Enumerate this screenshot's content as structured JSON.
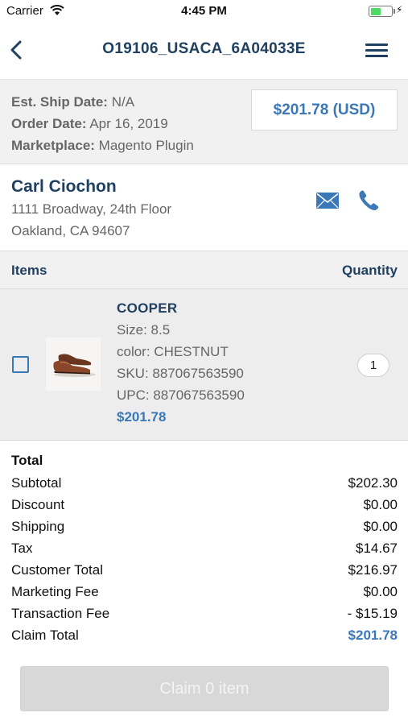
{
  "status_bar": {
    "carrier": "Carrier",
    "time": "4:45 PM",
    "battery_level": 0.45
  },
  "nav": {
    "title": "O19106_USACA_6A04033E",
    "back_icon": "chevron-left-icon",
    "menu_icon": "hamburger-menu-icon"
  },
  "order": {
    "ship_label": "Est. Ship Date:",
    "ship_value": "N/A",
    "date_label": "Order Date:",
    "date_value": "Apr 16, 2019",
    "marketplace_label": "Marketplace:",
    "marketplace_value": "Magento Plugin",
    "price": "$201.78 (USD)"
  },
  "customer": {
    "name": "Carl Ciochon",
    "address_line1": "1111 Broadway, 24th Floor",
    "address_line2": "Oakland, CA 94607",
    "mail_icon": "mail-icon",
    "phone_icon": "phone-icon"
  },
  "items_header": {
    "items": "Items",
    "quantity": "Quantity"
  },
  "items": [
    {
      "name": "COOPER",
      "size": "Size: 8.5",
      "color": "color: CHESTNUT",
      "sku": "SKU: 887067563590",
      "upc": "UPC: 887067563590",
      "price": "$201.78",
      "quantity": "1",
      "checked": false
    }
  ],
  "totals": {
    "title": "Total",
    "rows": [
      {
        "label": "Subtotal",
        "value": "$202.30"
      },
      {
        "label": "Discount",
        "value": "$0.00"
      },
      {
        "label": "Shipping",
        "value": "$0.00"
      },
      {
        "label": "Tax",
        "value": "$14.67"
      },
      {
        "label": "Customer Total",
        "value": "$216.97"
      },
      {
        "label": "Marketing Fee",
        "value": "$0.00"
      },
      {
        "label": "Transaction Fee",
        "value": "- $15.19"
      },
      {
        "label": "Claim Total",
        "value": "$201.78"
      }
    ]
  },
  "claim_button": {
    "label": "Claim 0 item"
  },
  "colors": {
    "primary": "#1f4060",
    "accent": "#3a78b8",
    "background": "#f1f1f1"
  }
}
